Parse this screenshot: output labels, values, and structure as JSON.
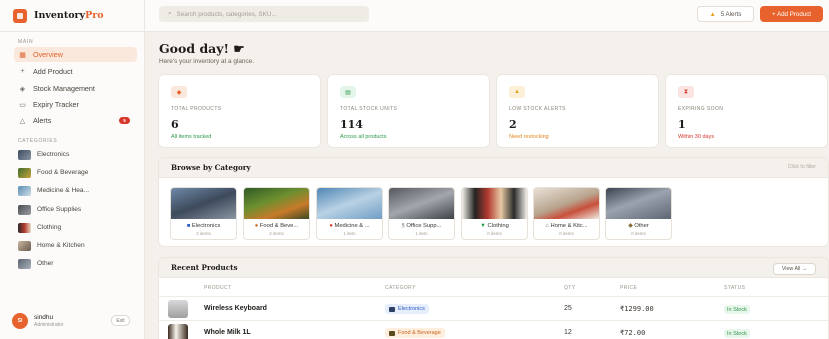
{
  "brand": {
    "name_prefix": "Inventory",
    "name_suffix": "Pro"
  },
  "sidebar": {
    "main_label": "MAIN",
    "nav": [
      {
        "label": "Overview",
        "icon": "grid-icon",
        "active": true
      },
      {
        "label": "Add Product",
        "icon": "plus-icon"
      },
      {
        "label": "Stock Management",
        "icon": "box-icon"
      },
      {
        "label": "Expiry Tracker",
        "icon": "calendar-icon"
      },
      {
        "label": "Alerts",
        "icon": "bell-icon",
        "badge": "5"
      }
    ],
    "categories_label": "CATEGORIES",
    "categories": [
      {
        "label": "Electronics"
      },
      {
        "label": "Food & Beverage"
      },
      {
        "label": "Medicine & Hea..."
      },
      {
        "label": "Office Supplies"
      },
      {
        "label": "Clothing"
      },
      {
        "label": "Home & Kitchen"
      },
      {
        "label": "Other"
      }
    ],
    "user": {
      "initials": "SI",
      "name": "sindhu",
      "role": "Administrator",
      "exit_label": "Exit"
    }
  },
  "topbar": {
    "search_placeholder": "Search products, categories, SKU...",
    "alerts_label": "5 Alerts",
    "add_label": "+ Add Product"
  },
  "greeting": {
    "title": "Good day! ",
    "subtitle": "Here's your inventory at a glance."
  },
  "stats": [
    {
      "label": "TOTAL PRODUCTS",
      "value": "6",
      "note": "All items tracked",
      "icon": "box-icon",
      "accent": "#e8622d",
      "note_color": "#2c9a4b"
    },
    {
      "label": "TOTAL STOCK UNITS",
      "value": "114",
      "note": "Across all products",
      "icon": "layers-icon",
      "accent": "#2c9a4b",
      "note_color": "#2c9a4b"
    },
    {
      "label": "LOW STOCK ALERTS",
      "value": "2",
      "note": "Need restocking",
      "icon": "warning-icon",
      "accent": "#e3a11c",
      "note_color": "#e3861c"
    },
    {
      "label": "EXPIRING SOON",
      "value": "1",
      "note": "Within 30 days",
      "icon": "hourglass-icon",
      "accent": "#d8362b",
      "note_color": "#d8362b"
    }
  ],
  "browse": {
    "title": "Browse by Category",
    "hint": "Click to filter",
    "cards": [
      {
        "name": "Electronics",
        "count": "2 items"
      },
      {
        "name": "Food & Beve...",
        "count": "2 items"
      },
      {
        "name": "Medicine & ...",
        "count": "1 item"
      },
      {
        "name": "Office Supp...",
        "count": "1 item"
      },
      {
        "name": "Clothing",
        "count": "0 items"
      },
      {
        "name": "Home & Kitc...",
        "count": "0 items"
      },
      {
        "name": "Other",
        "count": "0 items"
      }
    ]
  },
  "recent": {
    "title": "Recent Products",
    "view_all": "View All →",
    "columns": [
      "PRODUCT",
      "CATEGORY",
      "QTY",
      "PRICE",
      "STATUS"
    ],
    "rows": [
      {
        "name": "Wireless Keyboard",
        "category": "Electronics",
        "qty": "25",
        "price": "₹1299.00",
        "status": "In Stock",
        "pill_bg": "#e6eefb",
        "pill_fg": "#2e5cc7"
      },
      {
        "name": "Whole Milk 1L",
        "category": "Food & Beverage",
        "qty": "12",
        "price": "₹72.00",
        "status": "In Stock",
        "pill_bg": "#fdeedd",
        "pill_fg": "#c9651e"
      }
    ]
  }
}
